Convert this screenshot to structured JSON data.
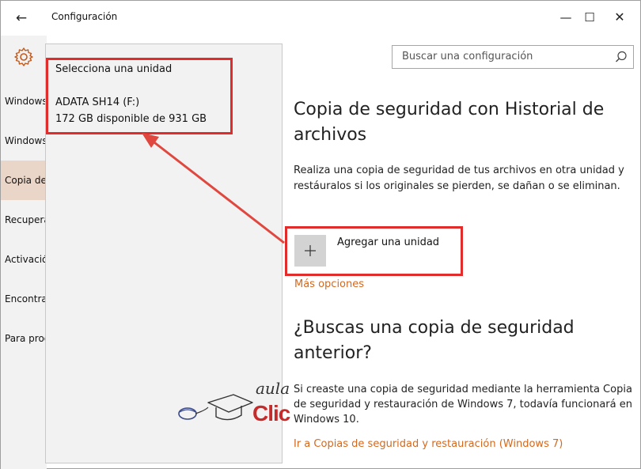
{
  "window": {
    "title": "Configuración",
    "back_glyph": "←",
    "minimize_glyph": "—",
    "maximize_glyph": "☐",
    "close_glyph": "✕"
  },
  "sidebar": {
    "icon": "gear-icon",
    "items": [
      {
        "label": "Windows Update"
      },
      {
        "label": "Windows Defender"
      },
      {
        "label": "Copia de seguridad"
      },
      {
        "label": "Recuperación"
      },
      {
        "label": "Activación"
      },
      {
        "label": "Encontrar mi dispositivo"
      },
      {
        "label": "Para programadores"
      }
    ]
  },
  "flyout": {
    "heading": "Selecciona una unidad",
    "drive_name": "ADATA SH14 (F:)",
    "drive_space": "172 GB disponible de 931 GB"
  },
  "search": {
    "placeholder": "Buscar una configuración",
    "icon": "search-icon"
  },
  "main": {
    "title": "Copia de seguridad con Historial de archivos",
    "description": "Realiza una copia de seguridad de tus archivos en otra unidad y restáuralos si los originales se pierden, se dañan o se eliminan.",
    "add_drive_label": "Agregar una unidad",
    "add_drive_icon": "plus-icon",
    "more_options_link": "Más opciones",
    "section2_title": "¿Buscas una copia de seguridad anterior?",
    "section2_description": "Si creaste una copia de seguridad mediante la herramienta Copia de seguridad y restauración de Windows 7, todavía funcionará en Windows 10.",
    "restore_link": "Ir a Copias de seguridad y restauración (Windows 7)"
  },
  "watermark": {
    "top": "aula",
    "bottom": "Clic"
  },
  "colors": {
    "accent_link": "#d3691f",
    "annotation_red": "#e22b2b",
    "active_nav": "#e9d6c9",
    "panel_bg": "#f2f2f2"
  }
}
